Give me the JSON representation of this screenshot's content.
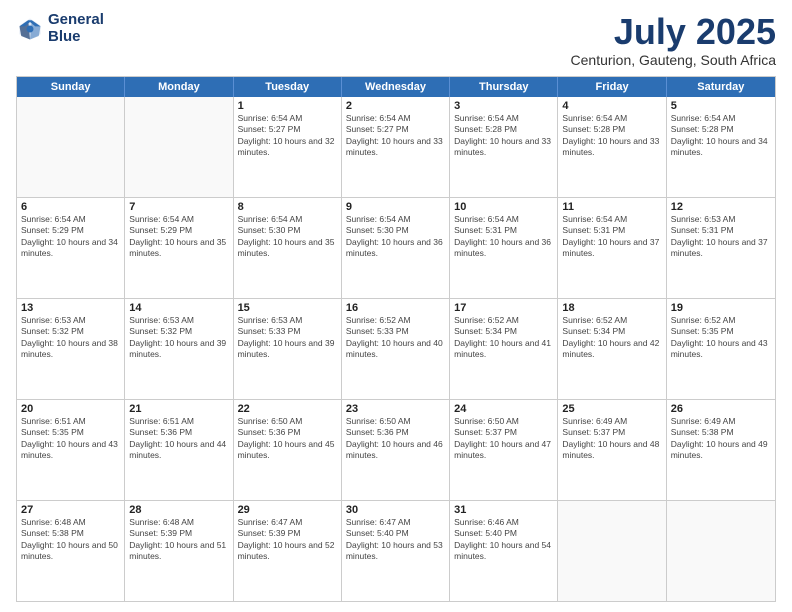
{
  "header": {
    "logo_line1": "General",
    "logo_line2": "Blue",
    "month": "July 2025",
    "location": "Centurion, Gauteng, South Africa"
  },
  "days_of_week": [
    "Sunday",
    "Monday",
    "Tuesday",
    "Wednesday",
    "Thursday",
    "Friday",
    "Saturday"
  ],
  "weeks": [
    [
      {
        "day": "",
        "empty": true
      },
      {
        "day": "",
        "empty": true
      },
      {
        "day": "1",
        "rise": "6:54 AM",
        "set": "5:27 PM",
        "daylight": "10 hours and 32 minutes."
      },
      {
        "day": "2",
        "rise": "6:54 AM",
        "set": "5:27 PM",
        "daylight": "10 hours and 33 minutes."
      },
      {
        "day": "3",
        "rise": "6:54 AM",
        "set": "5:28 PM",
        "daylight": "10 hours and 33 minutes."
      },
      {
        "day": "4",
        "rise": "6:54 AM",
        "set": "5:28 PM",
        "daylight": "10 hours and 33 minutes."
      },
      {
        "day": "5",
        "rise": "6:54 AM",
        "set": "5:28 PM",
        "daylight": "10 hours and 34 minutes."
      }
    ],
    [
      {
        "day": "6",
        "rise": "6:54 AM",
        "set": "5:29 PM",
        "daylight": "10 hours and 34 minutes."
      },
      {
        "day": "7",
        "rise": "6:54 AM",
        "set": "5:29 PM",
        "daylight": "10 hours and 35 minutes."
      },
      {
        "day": "8",
        "rise": "6:54 AM",
        "set": "5:30 PM",
        "daylight": "10 hours and 35 minutes."
      },
      {
        "day": "9",
        "rise": "6:54 AM",
        "set": "5:30 PM",
        "daylight": "10 hours and 36 minutes."
      },
      {
        "day": "10",
        "rise": "6:54 AM",
        "set": "5:31 PM",
        "daylight": "10 hours and 36 minutes."
      },
      {
        "day": "11",
        "rise": "6:54 AM",
        "set": "5:31 PM",
        "daylight": "10 hours and 37 minutes."
      },
      {
        "day": "12",
        "rise": "6:53 AM",
        "set": "5:31 PM",
        "daylight": "10 hours and 37 minutes."
      }
    ],
    [
      {
        "day": "13",
        "rise": "6:53 AM",
        "set": "5:32 PM",
        "daylight": "10 hours and 38 minutes."
      },
      {
        "day": "14",
        "rise": "6:53 AM",
        "set": "5:32 PM",
        "daylight": "10 hours and 39 minutes."
      },
      {
        "day": "15",
        "rise": "6:53 AM",
        "set": "5:33 PM",
        "daylight": "10 hours and 39 minutes."
      },
      {
        "day": "16",
        "rise": "6:52 AM",
        "set": "5:33 PM",
        "daylight": "10 hours and 40 minutes."
      },
      {
        "day": "17",
        "rise": "6:52 AM",
        "set": "5:34 PM",
        "daylight": "10 hours and 41 minutes."
      },
      {
        "day": "18",
        "rise": "6:52 AM",
        "set": "5:34 PM",
        "daylight": "10 hours and 42 minutes."
      },
      {
        "day": "19",
        "rise": "6:52 AM",
        "set": "5:35 PM",
        "daylight": "10 hours and 43 minutes."
      }
    ],
    [
      {
        "day": "20",
        "rise": "6:51 AM",
        "set": "5:35 PM",
        "daylight": "10 hours and 43 minutes."
      },
      {
        "day": "21",
        "rise": "6:51 AM",
        "set": "5:36 PM",
        "daylight": "10 hours and 44 minutes."
      },
      {
        "day": "22",
        "rise": "6:50 AM",
        "set": "5:36 PM",
        "daylight": "10 hours and 45 minutes."
      },
      {
        "day": "23",
        "rise": "6:50 AM",
        "set": "5:36 PM",
        "daylight": "10 hours and 46 minutes."
      },
      {
        "day": "24",
        "rise": "6:50 AM",
        "set": "5:37 PM",
        "daylight": "10 hours and 47 minutes."
      },
      {
        "day": "25",
        "rise": "6:49 AM",
        "set": "5:37 PM",
        "daylight": "10 hours and 48 minutes."
      },
      {
        "day": "26",
        "rise": "6:49 AM",
        "set": "5:38 PM",
        "daylight": "10 hours and 49 minutes."
      }
    ],
    [
      {
        "day": "27",
        "rise": "6:48 AM",
        "set": "5:38 PM",
        "daylight": "10 hours and 50 minutes."
      },
      {
        "day": "28",
        "rise": "6:48 AM",
        "set": "5:39 PM",
        "daylight": "10 hours and 51 minutes."
      },
      {
        "day": "29",
        "rise": "6:47 AM",
        "set": "5:39 PM",
        "daylight": "10 hours and 52 minutes."
      },
      {
        "day": "30",
        "rise": "6:47 AM",
        "set": "5:40 PM",
        "daylight": "10 hours and 53 minutes."
      },
      {
        "day": "31",
        "rise": "6:46 AM",
        "set": "5:40 PM",
        "daylight": "10 hours and 54 minutes."
      },
      {
        "day": "",
        "empty": true
      },
      {
        "day": "",
        "empty": true
      }
    ]
  ]
}
